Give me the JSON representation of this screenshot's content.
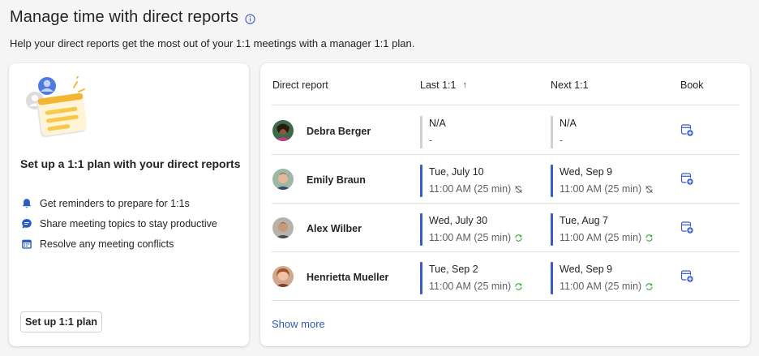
{
  "header": {
    "title": "Manage time with direct reports",
    "subtitle": "Help your direct reports get the most out of your 1:1 meetings with a manager 1:1 plan."
  },
  "plan_card": {
    "title": "Set up a 1:1 plan with your direct reports",
    "features": [
      {
        "icon": "bell-icon",
        "label": "Get reminders to prepare for 1:1s"
      },
      {
        "icon": "chat-icon",
        "label": "Share meeting topics to stay productive"
      },
      {
        "icon": "calendar-icon",
        "label": "Resolve any meeting conflicts"
      }
    ],
    "button_label": "Set up 1:1 plan"
  },
  "table": {
    "columns": {
      "report": "Direct report",
      "last": "Last 1:1",
      "next": "Next 1:1",
      "book": "Book"
    },
    "sort_indicator": "↑",
    "rows": [
      {
        "name": "Debra Berger",
        "last": {
          "date": "N/A",
          "time": "-",
          "status": "none"
        },
        "next": {
          "date": "N/A",
          "time": "-",
          "status": "none"
        }
      },
      {
        "name": "Emily Braun",
        "last": {
          "date": "Tue, July 10",
          "time": "11:00 AM (25 min)",
          "status": "no-recurrence"
        },
        "next": {
          "date": "Wed, Sep 9",
          "time": "11:00 AM (25 min)",
          "status": "no-recurrence"
        }
      },
      {
        "name": "Alex Wilber",
        "last": {
          "date": "Wed, July 30",
          "time": "11:00 AM (25 min)",
          "status": "recurring"
        },
        "next": {
          "date": "Tue, Aug 7",
          "time": "11:00 AM (25 min)",
          "status": "recurring"
        }
      },
      {
        "name": "Henrietta Mueller",
        "last": {
          "date": "Tue, Sep 2",
          "time": "11:00 AM (25 min)",
          "status": "recurring"
        },
        "next": {
          "date": "Wed, Sep 9",
          "time": "11:00 AM (25 min)",
          "status": "recurring"
        }
      }
    ],
    "show_more": "Show more"
  },
  "colors": {
    "accent": "#3a5bc7",
    "link": "#2e5aac",
    "recurring": "#3fa43f",
    "muted": "#616161"
  }
}
